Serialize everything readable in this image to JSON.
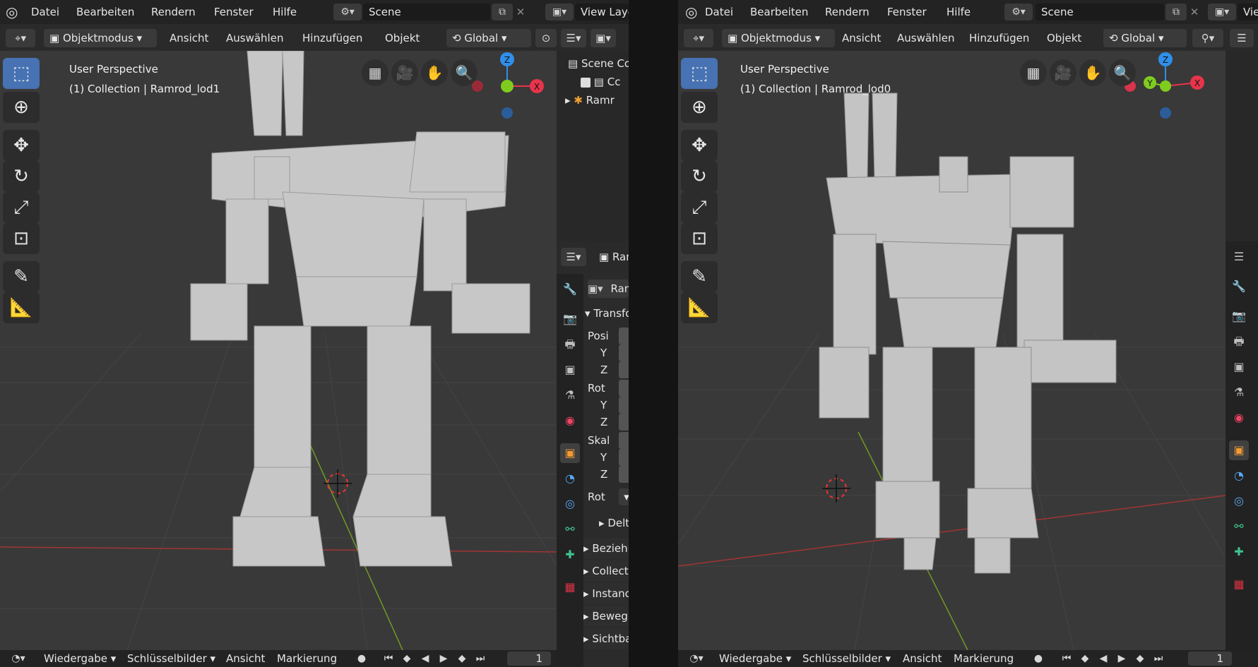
{
  "app": {
    "logo_icon": "blender-logo-icon"
  },
  "menu": [
    "Datei",
    "Bearbeiten",
    "Rendern",
    "Fenster",
    "Hilfe"
  ],
  "scene": {
    "icon": "scene-icon",
    "name": "Scene"
  },
  "view_layer": {
    "icon": "view-layer-icon",
    "name": "View Layer"
  },
  "header": {
    "mode": "Objektmodus",
    "menus": [
      "Ansicht",
      "Auswählen",
      "Hinzufügen",
      "Objekt"
    ],
    "orientation": "Global"
  },
  "left_view": {
    "perspective": "User Perspective",
    "collection": "(1) Collection | Ramrod_lod1"
  },
  "right_view": {
    "perspective": "User Perspective",
    "collection": "(1) Collection | Ramrod_lod0"
  },
  "gizmo": {
    "x": "X",
    "y": "Y",
    "z": "Z"
  },
  "outliner": {
    "scene_collection": "Scene Co",
    "collection": "Cc",
    "object": "Ramr"
  },
  "properties": {
    "object_header": "Ramrod_",
    "object_name": "Ramro",
    "transform_title": "Transformier",
    "rows": [
      {
        "label": "Posi"
      },
      {
        "label": "Y"
      },
      {
        "label": "Z"
      },
      {
        "label": "Rot"
      },
      {
        "label": "Y"
      },
      {
        "label": "Z"
      },
      {
        "label": "Skal"
      },
      {
        "label": "Y"
      },
      {
        "label": "Z"
      }
    ],
    "rot_mode": "Rot",
    "delta": "Delta-Tran",
    "sections": [
      "Beziehunge",
      "Collections",
      "Instancing",
      "Bewegungs",
      "Sichtbarkeit"
    ]
  },
  "timeline": {
    "menus": [
      "Wiedergabe",
      "Schlüsselbilder",
      "Ansicht",
      "Markierung"
    ],
    "frame": "1"
  },
  "colors": {
    "active_tool": "#4772b3",
    "axis_x": "#e8344a",
    "axis_y": "#7fcc1f",
    "axis_z": "#2f8fea"
  }
}
